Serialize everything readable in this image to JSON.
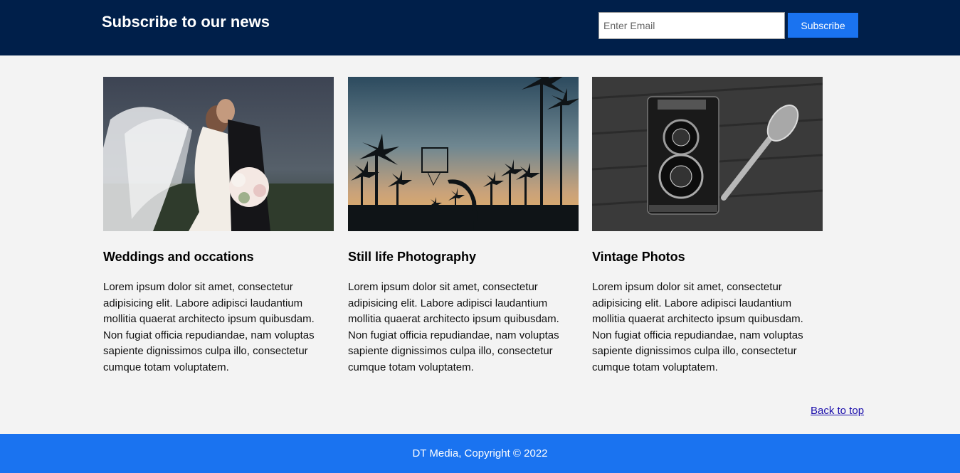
{
  "header": {
    "title": "Subscribe to our news",
    "email_placeholder": "Enter Email",
    "subscribe_label": "Subscribe"
  },
  "cards": [
    {
      "title": "Weddings and occations",
      "text": "Lorem ipsum dolor sit amet, consectetur adipisicing elit. Labore adipisci laudantium mollitia quaerat architecto ipsum quibusdam. Non fugiat officia repudiandae, nam voluptas sapiente dignissimos culpa illo, consectetur cumque totam voluptatem."
    },
    {
      "title": "Still life Photography",
      "text": "Lorem ipsum dolor sit amet, consectetur adipisicing elit. Labore adipisci laudantium mollitia quaerat architecto ipsum quibusdam. Non fugiat officia repudiandae, nam voluptas sapiente dignissimos culpa illo, consectetur cumque totam voluptatem."
    },
    {
      "title": "Vintage Photos",
      "text": "Lorem ipsum dolor sit amet, consectetur adipisicing elit. Labore adipisci laudantium mollitia quaerat architecto ipsum quibusdam. Non fugiat officia repudiandae, nam voluptas sapiente dignissimos culpa illo, consectetur cumque totam voluptatem."
    }
  ],
  "back_to_top": "Back to top",
  "footer": {
    "text": "DT Media, Copyright © 2022"
  },
  "colors": {
    "header_bg": "#001f4a",
    "accent": "#1a73f0",
    "page_bg": "#f3f3f3"
  }
}
